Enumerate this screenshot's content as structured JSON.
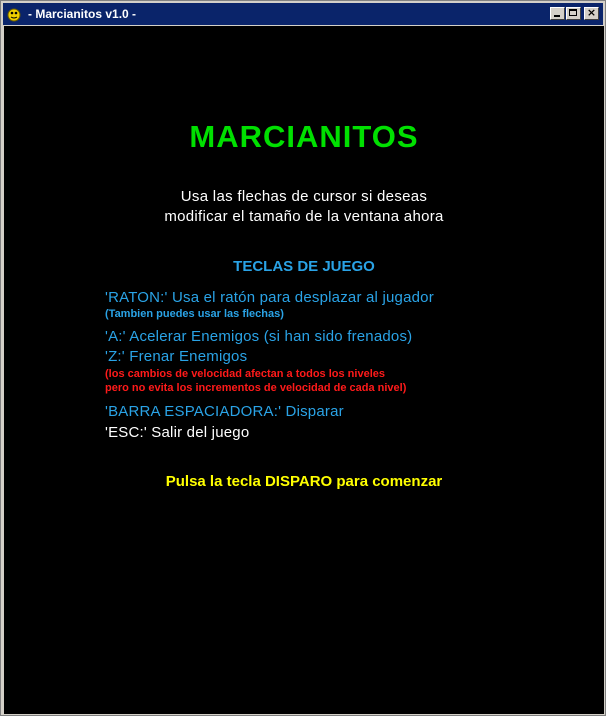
{
  "window": {
    "title": "- Marcianitos v1.0 -",
    "icon": "pygame-snake-icon",
    "buttons": {
      "minimize": "minimize-icon",
      "maximize": "maximize-icon",
      "close_glyph": "×"
    }
  },
  "colors": {
    "background": "#000000",
    "title": "#00e000",
    "info": "#2aa3e6",
    "warning": "#ff1a1a",
    "text": "#ffffff",
    "prompt": "#ffff00",
    "titlebar": "#0a246a"
  },
  "screen": {
    "game_title": "MARCIANITOS",
    "intro_line1": "Usa las flechas de cursor si deseas",
    "intro_line2": "modificar el tamaño de la ventana ahora",
    "keys_header": "TECLAS DE JUEGO",
    "raton": "'RATON:'  Usa el ratón para desplazar al jugador",
    "raton_note": "(Tambien puedes usar las flechas)",
    "key_a": "'A:' Acelerar Enemigos (si han sido frenados)",
    "key_z": "'Z:'  Frenar Enemigos",
    "speed_note1": "(los cambios de velocidad afectan a todos los niveles",
    "speed_note2": "pero no evita los incrementos de velocidad de cada nivel)",
    "space": "'BARRA ESPACIADORA:'  Disparar",
    "esc": "'ESC:'  Salir del juego",
    "start_prompt": "Pulsa la tecla DISPARO para comenzar"
  }
}
